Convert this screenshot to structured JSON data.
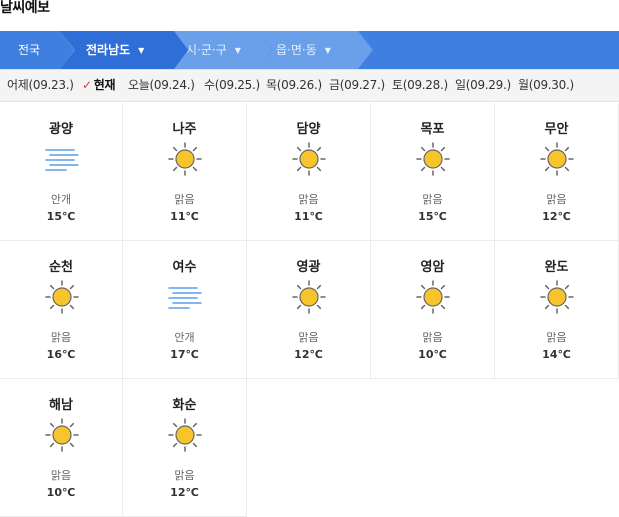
{
  "title": "날씨예보",
  "nav": {
    "country": "전국",
    "province": "전라남도",
    "city": "시·군·구",
    "town": "읍·면·동"
  },
  "days": [
    {
      "label": "어제(09.23.)",
      "current": false
    },
    {
      "label": "현재",
      "current": true
    },
    {
      "label": "오늘(09.24.)",
      "current": false
    },
    {
      "label": "수(09.25.)",
      "current": false
    },
    {
      "label": "목(09.26.)",
      "current": false
    },
    {
      "label": "금(09.27.)",
      "current": false
    },
    {
      "label": "토(09.28.)",
      "current": false
    },
    {
      "label": "일(09.29.)",
      "current": false
    },
    {
      "label": "월(09.30.)",
      "current": false
    }
  ],
  "weather": [
    {
      "city": "광양",
      "condition": "안개",
      "temp": "15℃",
      "icon": "fog-icon"
    },
    {
      "city": "나주",
      "condition": "맑음",
      "temp": "11℃",
      "icon": "sun-icon"
    },
    {
      "city": "담양",
      "condition": "맑음",
      "temp": "11℃",
      "icon": "sun-icon"
    },
    {
      "city": "목포",
      "condition": "맑음",
      "temp": "15℃",
      "icon": "sun-icon"
    },
    {
      "city": "무안",
      "condition": "맑음",
      "temp": "12℃",
      "icon": "sun-icon"
    },
    {
      "city": "순천",
      "condition": "맑음",
      "temp": "16℃",
      "icon": "sun-icon"
    },
    {
      "city": "여수",
      "condition": "안개",
      "temp": "17℃",
      "icon": "fog-icon"
    },
    {
      "city": "영광",
      "condition": "맑음",
      "temp": "12℃",
      "icon": "sun-icon"
    },
    {
      "city": "영암",
      "condition": "맑음",
      "temp": "10℃",
      "icon": "sun-icon"
    },
    {
      "city": "완도",
      "condition": "맑음",
      "temp": "14℃",
      "icon": "sun-icon"
    },
    {
      "city": "해남",
      "condition": "맑음",
      "temp": "10℃",
      "icon": "sun-icon"
    },
    {
      "city": "화순",
      "condition": "맑음",
      "temp": "12℃",
      "icon": "sun-icon"
    }
  ],
  "colors": {
    "nav_blue": "#3f7fe0",
    "sun": "#f7c52b",
    "fog": "#5b9fe8",
    "check_red": "#e03a3a"
  }
}
